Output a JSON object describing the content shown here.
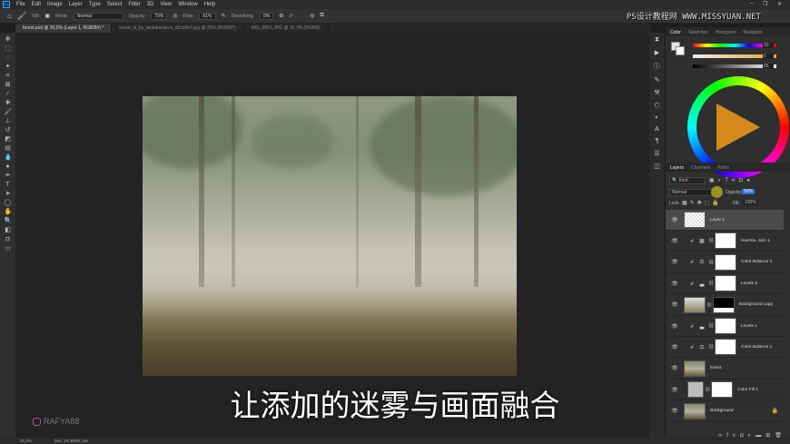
{
  "menu": {
    "app_icon": "Ps",
    "items": [
      "File",
      "Edit",
      "Image",
      "Layer",
      "Type",
      "Select",
      "Filter",
      "3D",
      "View",
      "Window",
      "Help"
    ]
  },
  "options": {
    "brush_size": "500",
    "mode_label": "Mode:",
    "mode": "Normal",
    "opacity_label": "Opacity:",
    "opacity": "79%",
    "flow_label": "Flow:",
    "flow": "61%",
    "smoothing_label": "Smoothing:",
    "smoothing": "0%",
    "angle": "0°"
  },
  "tabs": [
    {
      "label": "forest.psd @ 30,5% (Layer 1, RGB/8#) *",
      "active": true
    },
    {
      "label": "forest_iii_by_andukasitock_d1cd4a7.jpg @ 25% (RGB/8*)"
    },
    {
      "label": "IMG_9951.JPG @ 16,7% (RGB/8)"
    }
  ],
  "watermark_site": "PS设计教程网  WWW.MISSYUAN.NET",
  "subtitle": "让添加的迷雾与画面融合",
  "instagram": "RAFYA88",
  "status": {
    "zoom": "30,3%",
    "doc": "Doc: 19,3M/91,1M"
  },
  "color_panel": {
    "tabs": [
      "Color",
      "Swatches",
      "Histogram",
      "Navigator"
    ],
    "values": [
      "30",
      "5",
      "85"
    ],
    "units": [
      "°",
      "%",
      "%"
    ]
  },
  "layers_panel": {
    "tabs": [
      "Layers",
      "Channels",
      "Paths"
    ],
    "filter": "Kind",
    "blend_mode": "Normal",
    "opacity_label": "Opacity:",
    "opacity": "50%",
    "lock_label": "Lock:",
    "fill_label": "Fill:",
    "fill": "100%",
    "layers": [
      {
        "name": "Layer 1",
        "selected": true,
        "type": "pixel"
      },
      {
        "name": "Hue/Sa...tion 1",
        "type": "adj",
        "icon": "▦"
      },
      {
        "name": "Color Balance 2",
        "type": "adj",
        "icon": "⚖"
      },
      {
        "name": "Levels 2",
        "type": "adj",
        "icon": "▃"
      },
      {
        "name": "Background copy",
        "type": "masked"
      },
      {
        "name": "Levels 1",
        "type": "adj",
        "icon": "▃"
      },
      {
        "name": "Color Balance 1",
        "type": "adj",
        "icon": "⚖"
      },
      {
        "name": "forest",
        "type": "photo"
      },
      {
        "name": "Color Fill 1",
        "type": "fill"
      },
      {
        "name": "Background",
        "type": "bg"
      }
    ]
  },
  "colors": {
    "accent": "#31a8ff",
    "panel": "#2f2f2f",
    "selected_layer": "#4a4a4a"
  }
}
